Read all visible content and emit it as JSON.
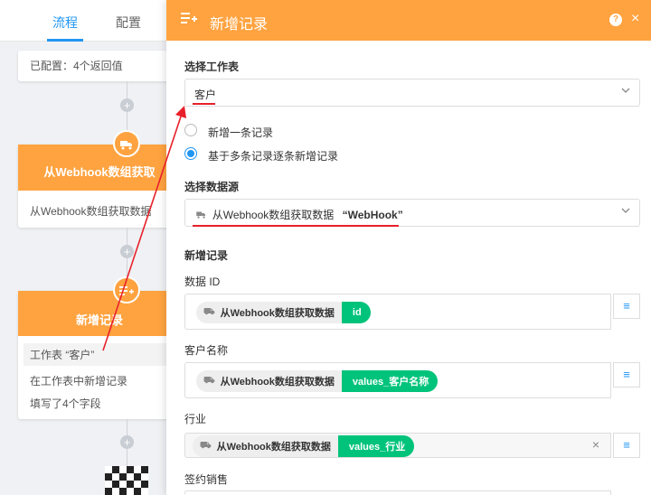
{
  "tabs": {
    "flow": "流程",
    "config": "配置"
  },
  "canvas": {
    "card1_line": "已配置：4个返回值",
    "card2_title": "从Webhook数组获取",
    "card2_line": "从Webhook数组获取数据",
    "card3_title": "新增记录",
    "card3_line1": "工作表 “客户”",
    "card3_line2": "在工作表中新增记录",
    "card3_line3": "填写了4个字段",
    "plus_glyph": "+"
  },
  "panel": {
    "title": "新增记录",
    "help": "?",
    "close": "×",
    "select_sheet_label": "选择工作表",
    "sheet_value": "客户",
    "radio_single": "新增一条记录",
    "radio_multi": "基于多条记录逐条新增记录",
    "select_source_label": "选择数据源",
    "source_value": "从Webhook数组获取数据",
    "source_quote": "“WebHook”",
    "new_records_label": "新增记录",
    "fields": [
      {
        "label": "数据 ID",
        "src": "从Webhook数组获取数据",
        "val": "id"
      },
      {
        "label": "客户名称",
        "src": "从Webhook数组获取数据",
        "val": "values_客户名称"
      },
      {
        "label": "行业",
        "src": "从Webhook数组获取数据",
        "val": "values_行业"
      },
      {
        "label": "签约销售"
      }
    ]
  },
  "colors": {
    "accent": "#ffa340",
    "primary": "#2196f3",
    "tag_green": "#00c37b",
    "annotation_red": "#e8202a"
  }
}
